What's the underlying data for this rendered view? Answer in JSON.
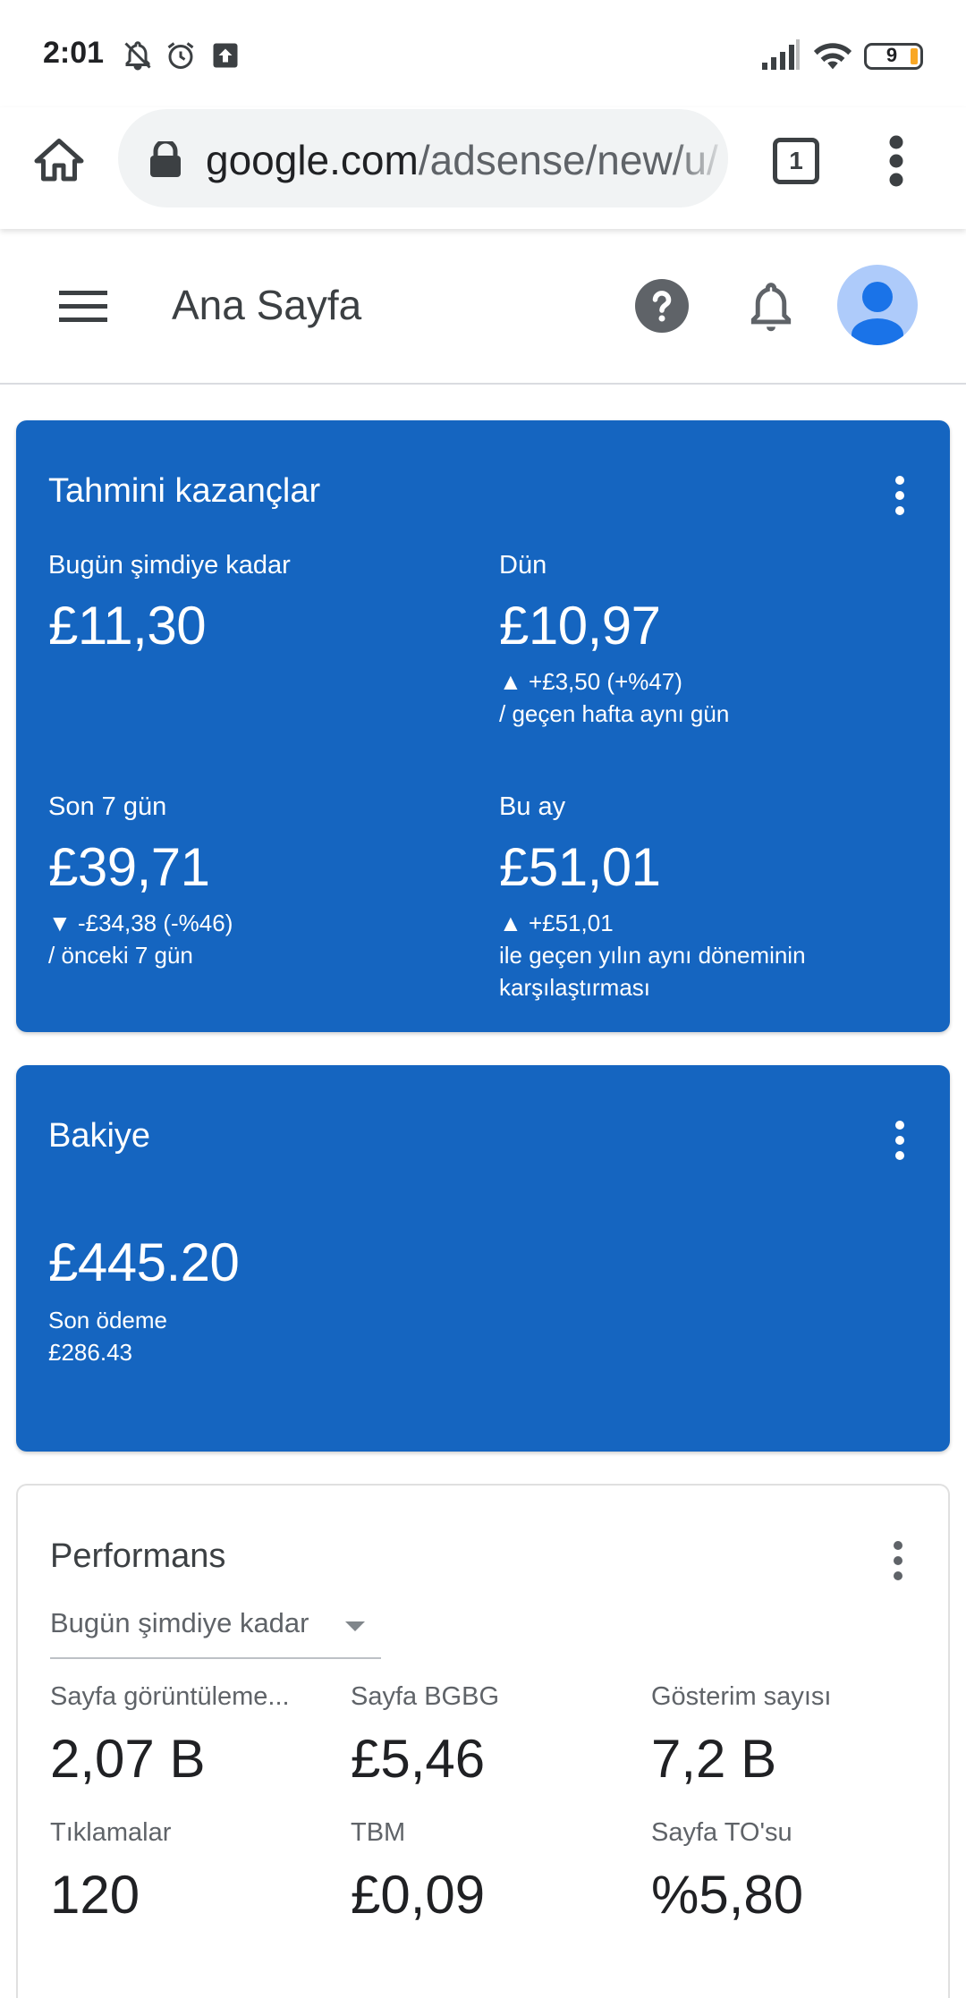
{
  "status_bar": {
    "time": "2:01",
    "icons": [
      "bell-off-icon",
      "alarm-icon",
      "upload-icon"
    ],
    "battery_level": "9"
  },
  "browser": {
    "url_host": "google.com",
    "url_path": "/adsense/new/u/",
    "tab_count": "1"
  },
  "header": {
    "title": "Ana Sayfa"
  },
  "earnings": {
    "title": "Tahmini kazançlar",
    "today": {
      "label": "Bugün şimdiye kadar",
      "value": "£11,30"
    },
    "yesterday": {
      "label": "Dün",
      "value": "£10,97",
      "change": "▲ +£3,50 (+%47)",
      "note": "/ geçen hafta aynı gün"
    },
    "last7": {
      "label": "Son 7 gün",
      "value": "£39,71",
      "change": "▼ -£34,38 (-%46)",
      "note": "/ önceki 7 gün"
    },
    "this_month": {
      "label": "Bu ay",
      "value": "£51,01",
      "change": "▲ +£51,01",
      "note_line1": "ile geçen yılın aynı döneminin",
      "note_line2": "karşılaştırması"
    }
  },
  "balance": {
    "title": "Bakiye",
    "value": "£445.20",
    "last_payment_label": "Son ödeme",
    "last_payment_value": "£286.43"
  },
  "performance": {
    "title": "Performans",
    "filter": "Bugün şimdiye kadar",
    "metrics": [
      {
        "label": "Sayfa görüntüleme...",
        "value": "2,07 B"
      },
      {
        "label": "Sayfa BGBG",
        "value": "£5,46"
      },
      {
        "label": "Gösterim sayısı",
        "value": "7,2 B"
      },
      {
        "label": "Tıklamalar",
        "value": "120"
      },
      {
        "label": "TBM",
        "value": "£0,09"
      },
      {
        "label": "Sayfa TO'su",
        "value": "%5,80"
      }
    ]
  },
  "colors": {
    "card_blue": "#1565c0",
    "avatar_bg": "#aecbfa",
    "avatar_fg": "#1a73e8"
  }
}
